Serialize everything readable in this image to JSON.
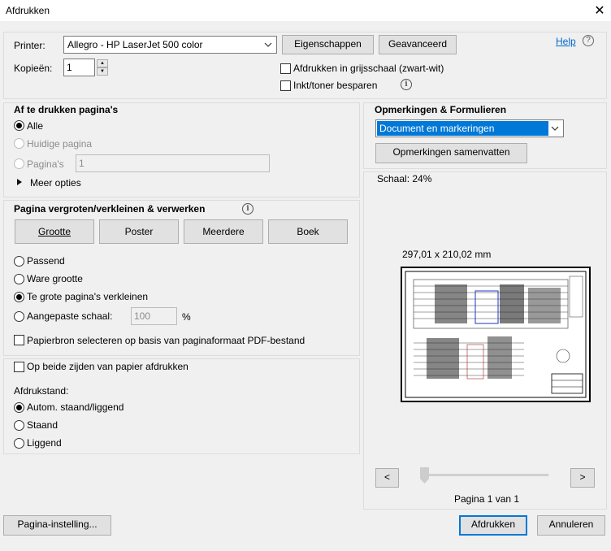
{
  "window": {
    "title": "Afdrukken"
  },
  "header": {
    "printer_label": "Printer:",
    "printer_value": "Allegro - HP LaserJet 500 color",
    "properties_button": "Eigenschappen",
    "advanced_button": "Geavanceerd",
    "help_link": "Help",
    "copies_label": "Kopieën:",
    "copies_value": "1",
    "grayscale_label": "Afdrukken in grijsschaal (zwart-wit)",
    "grayscale_checked": false,
    "save_ink_label": "Inkt/toner besparen",
    "save_ink_checked": false
  },
  "pages_section": {
    "title": "Af te drukken pagina's",
    "options": [
      "Alle",
      "Huidige pagina",
      "Pagina's"
    ],
    "selected": "Alle",
    "pages_value": "1",
    "more_options": "Meer opties"
  },
  "sizing_section": {
    "title": "Pagina vergroten/verkleinen & verwerken",
    "buttons": [
      "Grootte",
      "Poster",
      "Meerdere",
      "Boek"
    ],
    "active_button": "Grootte",
    "options": [
      "Passend",
      "Ware grootte",
      "Te grote pagina's verkleinen",
      "Aangepaste schaal:"
    ],
    "selected": "Te grote pagina's verkleinen",
    "custom_scale_value": "100",
    "percent_symbol": "%",
    "paper_source_label": "Papierbron selecteren op basis van paginaformaat PDF-bestand",
    "paper_source_checked": false
  },
  "duplex_section": {
    "both_sides_label": "Op beide zijden van papier afdrukken",
    "both_sides_checked": false,
    "orientation_title": "Afdrukstand:",
    "orientation_options": [
      "Autom. staand/liggend",
      "Staand",
      "Liggend"
    ],
    "orientation_selected": "Autom. staand/liggend"
  },
  "comments_section": {
    "title": "Opmerkingen & Formulieren",
    "dropdown_value": "Document en markeringen",
    "summarize_button": "Opmerkingen samenvatten"
  },
  "preview": {
    "scale_text": "Schaal:  24%",
    "paper_size": "297,01 x 210,02 mm",
    "prev_button": "<",
    "next_button": ">",
    "page_indicator": "Pagina 1 van 1",
    "slider_position": 0
  },
  "footer": {
    "page_setup_button": "Pagina-instelling...",
    "print_button": "Afdrukken",
    "cancel_button": "Annuleren"
  },
  "colors": {
    "accent": "#0078d7",
    "selection": "#0078d7",
    "link": "#0066cc"
  },
  "icons": [
    "close-icon",
    "help-icon",
    "info-icon",
    "chevron-down-icon",
    "triangle-right-icon"
  ]
}
